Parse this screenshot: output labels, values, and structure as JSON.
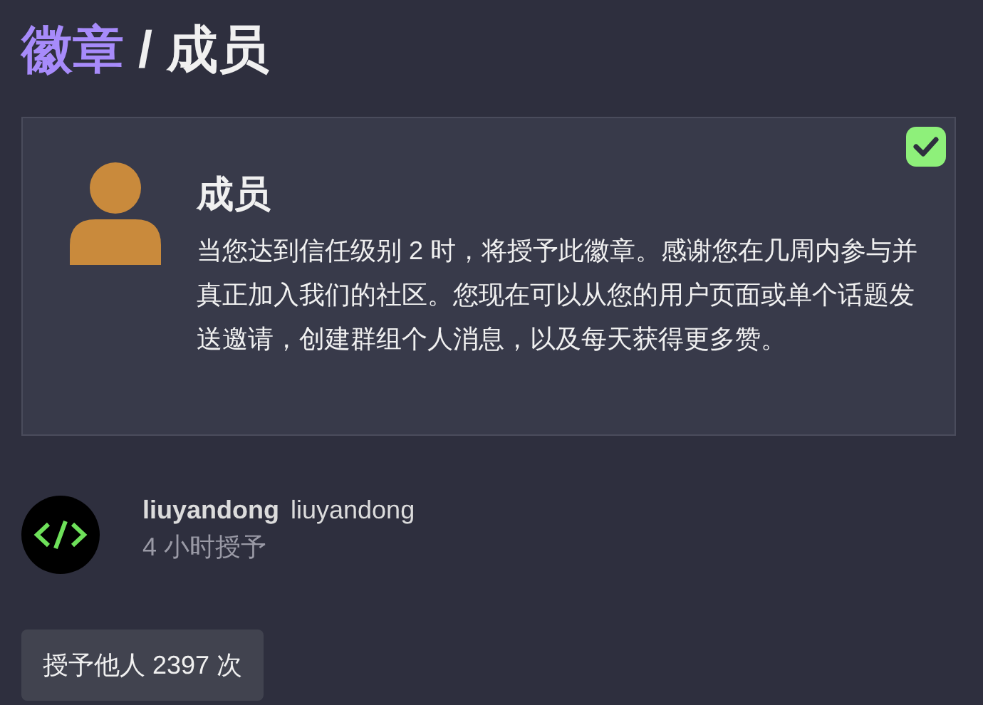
{
  "breadcrumb": {
    "section": "徽章",
    "separator": "/",
    "current": "成员"
  },
  "badge": {
    "title": "成员",
    "description": "当您达到信任级别 2 时，将授予此徽章。感谢您在几周内参与并真正加入我们的社区。您现在可以从您的用户页面或单个话题发送邀请，创建群组个人消息，以及每天获得更多赞。",
    "granted": true
  },
  "grants": [
    {
      "username": "liuyandong",
      "name": "liuyandong",
      "time": "4 小时授予"
    }
  ],
  "granted_count_button": "授予他人 2397 次"
}
